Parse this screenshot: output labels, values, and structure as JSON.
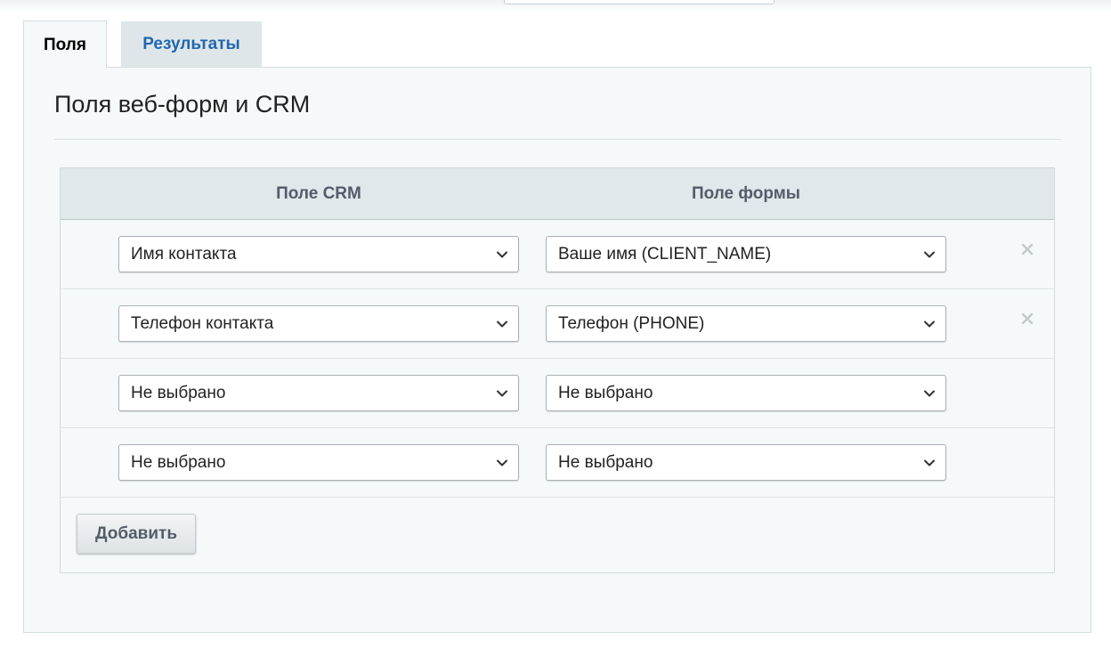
{
  "tabs": [
    {
      "label": "Поля",
      "active": true
    },
    {
      "label": "Результаты",
      "active": false
    }
  ],
  "section": {
    "title": "Поля веб-форм и CRM"
  },
  "table": {
    "headers": {
      "crm": "Поле CRM",
      "form": "Поле формы"
    },
    "rows": [
      {
        "crm_field": "Имя контакта",
        "form_field": "Ваше имя (CLIENT_NAME)",
        "removable": true
      },
      {
        "crm_field": "Телефон контакта",
        "form_field": "Телефон (PHONE)",
        "removable": true
      },
      {
        "crm_field": "Не выбрано",
        "form_field": "Не выбрано",
        "removable": false
      },
      {
        "crm_field": "Не выбрано",
        "form_field": "Не выбрано",
        "removable": false
      }
    ]
  },
  "buttons": {
    "add_label": "Добавить"
  },
  "icons": {
    "select_arrow": "chevron-down-icon",
    "remove": "close-icon"
  },
  "colors": {
    "panel_bg": "#f5f9f9",
    "header_bg": "#e1e8eb",
    "inactive_tab_bg": "#dfe6e9",
    "link_blue": "#2067b0",
    "header_text": "#535c69",
    "remove_icon": "#c3c9cd"
  }
}
